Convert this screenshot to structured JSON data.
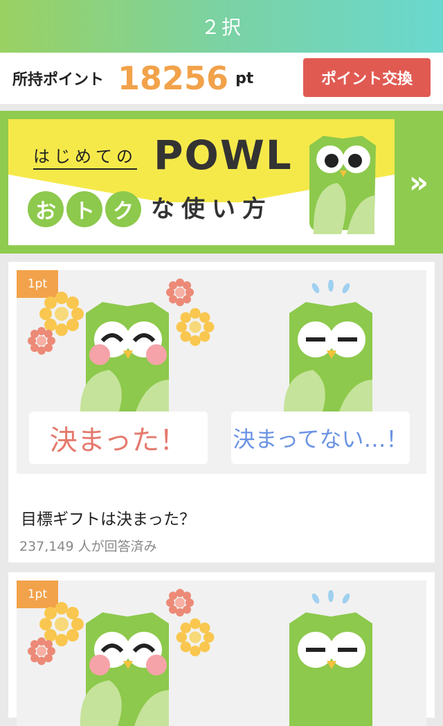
{
  "header": {
    "title": "２択"
  },
  "points": {
    "label": "所持ポイント",
    "value": "18256",
    "unit": "pt",
    "exchange_label": "ポイント交換"
  },
  "banner": {
    "intro": "はじめての",
    "brand": "POWL",
    "highlight_chars": [
      "お",
      "ト",
      "ク"
    ],
    "rest": "な使い方",
    "next_icon": "double-chevron-right-icon"
  },
  "cards": [
    {
      "badge": "1pt",
      "choice_left": "決まった！",
      "choice_right": "決まってない…！",
      "question": "目標ギフトは決まった？",
      "answered": "237,149 人が回答済み"
    },
    {
      "badge": "1pt"
    }
  ],
  "colors": {
    "header_gradient": [
      "#9ad162",
      "#6ad8cf"
    ],
    "points_value": "#f2a24a",
    "exchange_button": "#e05a52",
    "banner_green": "#8fcb4f",
    "badge": "#f2a24a",
    "choice_left": "#e57a6e",
    "choice_right": "#6a93e3"
  }
}
